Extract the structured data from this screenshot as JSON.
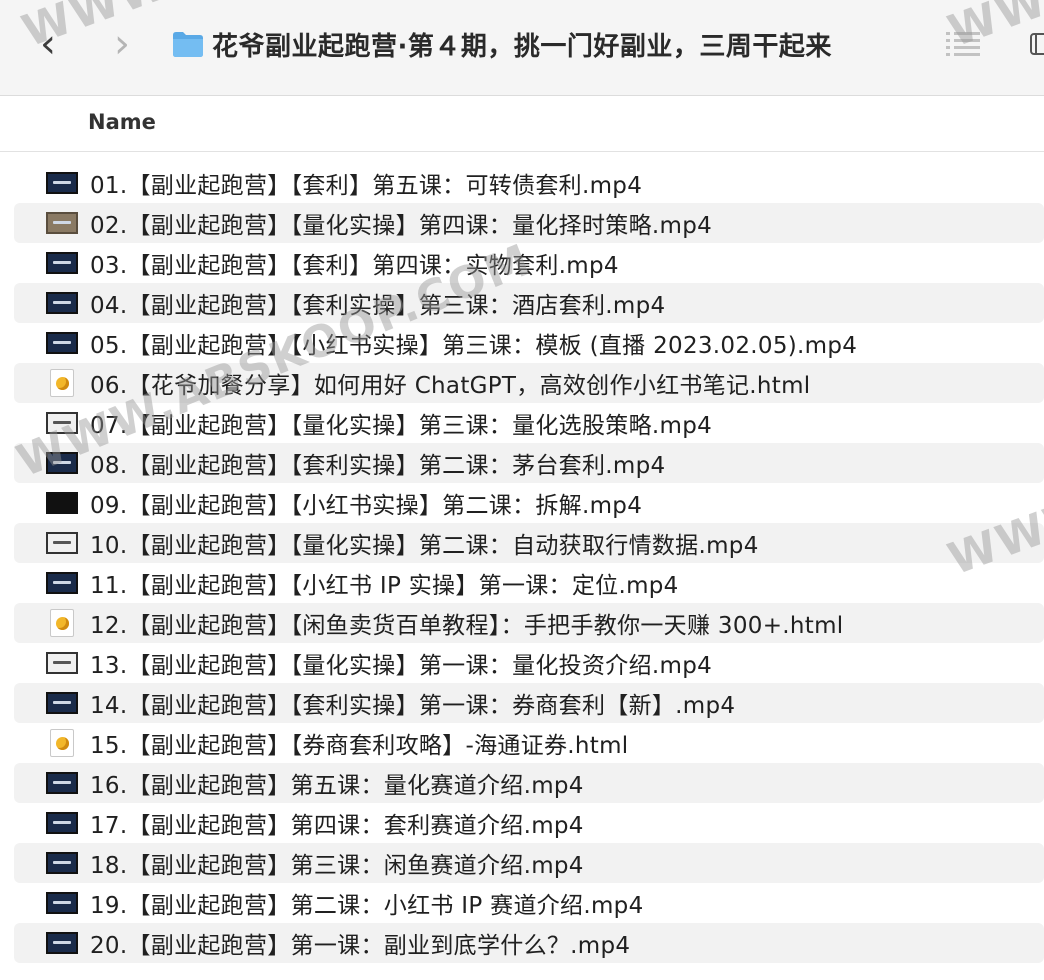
{
  "window": {
    "title": "花爷副业起跑营·第４期，挑一门好副业，三周干起来",
    "back_glyph": "‹",
    "forward_glyph": "›"
  },
  "columns": {
    "name_header": "Name"
  },
  "files": [
    {
      "name": "01.【副业起跑营】【套利】第五课：可转债套利.mp4",
      "type": "video",
      "thumb": "blue"
    },
    {
      "name": "02.【副业起跑营】【量化实操】第四课：量化择时策略.mp4",
      "type": "video",
      "thumb": "light"
    },
    {
      "name": "03.【副业起跑营】【套利】第四课：实物套利.mp4",
      "type": "video",
      "thumb": "blue"
    },
    {
      "name": "04.【副业起跑营】【套利实操】第三课：酒店套利.mp4",
      "type": "video",
      "thumb": "blue"
    },
    {
      "name": "05.【副业起跑营】【小红书实操】第三课：模板 (直播 2023.02.05).mp4",
      "type": "video",
      "thumb": "blue"
    },
    {
      "name": "06.【花爷加餐分享】如何用好 ChatGPT，高效创作小红书笔记.html",
      "type": "html",
      "thumb": "html"
    },
    {
      "name": "07.【副业起跑营】【量化实操】第三课：量化选股策略.mp4",
      "type": "video",
      "thumb": "white"
    },
    {
      "name": "08.【副业起跑营】【套利实操】第二课：茅台套利.mp4",
      "type": "video",
      "thumb": "blue"
    },
    {
      "name": "09.【副业起跑营】【小红书实操】第二课：拆解.mp4",
      "type": "video",
      "thumb": "dark"
    },
    {
      "name": "10.【副业起跑营】【量化实操】第二课：自动获取行情数据.mp4",
      "type": "video",
      "thumb": "white"
    },
    {
      "name": "11.【副业起跑营】【小红书 IP 实操】第一课：定位.mp4",
      "type": "video",
      "thumb": "blue"
    },
    {
      "name": "12.【副业起跑营】【闲鱼卖货百单教程】：手把手教你一天赚 300+.html",
      "type": "html",
      "thumb": "html"
    },
    {
      "name": "13.【副业起跑营】【量化实操】第一课：量化投资介绍.mp4",
      "type": "video",
      "thumb": "white"
    },
    {
      "name": "14.【副业起跑营】【套利实操】第一课：券商套利【新】.mp4",
      "type": "video",
      "thumb": "blue"
    },
    {
      "name": "15.【副业起跑营】【券商套利攻略】-海通证券.html",
      "type": "html",
      "thumb": "html"
    },
    {
      "name": "16.【副业起跑营】第五课：量化赛道介绍.mp4",
      "type": "video",
      "thumb": "blue"
    },
    {
      "name": "17.【副业起跑营】第四课：套利赛道介绍.mp4",
      "type": "video",
      "thumb": "blue"
    },
    {
      "name": "18.【副业起跑营】第三课：闲鱼赛道介绍.mp4",
      "type": "video",
      "thumb": "blue"
    },
    {
      "name": "19.【副业起跑营】第二课：小红书 IP 赛道介绍.mp4",
      "type": "video",
      "thumb": "blue"
    },
    {
      "name": "20.【副业起跑营】第一课：副业到底学什么？.mp4",
      "type": "video",
      "thumb": "blue"
    }
  ],
  "watermark": {
    "main": "WWW.ABSKOOP.COM",
    "corner": "WWW"
  },
  "colors": {
    "toolbar_bg": "#f5f5f5",
    "folder_blue": "#5aa9e6",
    "row_alt": "#f2f2f2"
  }
}
